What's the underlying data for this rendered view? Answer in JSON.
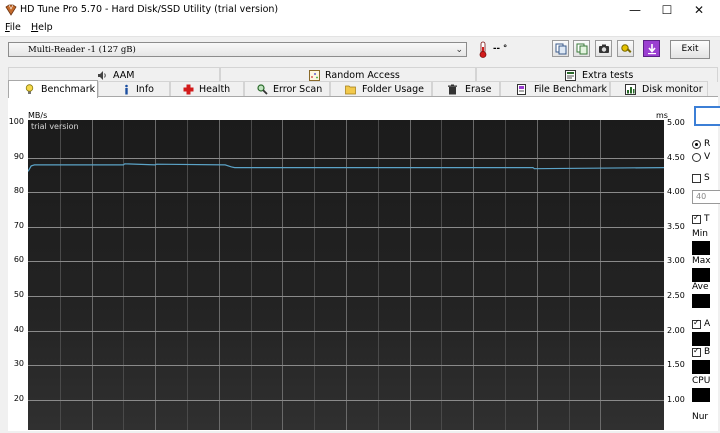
{
  "window": {
    "title": "HD Tune Pro 5.70 - Hard Disk/SSD Utility (trial version)",
    "minimize": "—",
    "maximize": "☐",
    "close": "✕"
  },
  "menu": [
    {
      "letter": "F",
      "rest": "ile"
    },
    {
      "letter": "H",
      "rest": "elp"
    }
  ],
  "toolbar": {
    "drive": "Multi-Reader  -1 (127 gB)",
    "temperature": "-- ",
    "temperature_unit": "°",
    "exit_label": "Exit"
  },
  "tabs_top": [
    "AAM",
    "Random Access",
    "Extra tests"
  ],
  "tabs_bottom": [
    "Benchmark",
    "Info",
    "Health",
    "Error Scan",
    "Folder Usage",
    "Erase",
    "File Benchmark",
    "Disk monitor"
  ],
  "active_tab": "Benchmark",
  "chart_data": {
    "type": "line",
    "watermark": "trial version",
    "ylabel_left": "MB/s",
    "ylabel_right": "ms",
    "yticks_left": [
      "100",
      "90",
      "80",
      "70",
      "60",
      "50",
      "40",
      "30",
      "20"
    ],
    "yticks_right": [
      "5.00",
      "4.50",
      "4.00",
      "3.50",
      "3.00",
      "2.50",
      "2.00",
      "1.50",
      "1.00"
    ],
    "ylim_left": [
      0,
      100
    ],
    "ylim_right": [
      0,
      5
    ],
    "grid": true,
    "series": [
      {
        "color": "#5ba3c7",
        "x": [
          0,
          0.5,
          1,
          15,
          15.2,
          20,
          20.2,
          31,
          32,
          32.5,
          45,
          60,
          79.4,
          79.6,
          100
        ],
        "values": [
          86,
          87.6,
          87.9,
          87.9,
          88.2,
          87.9,
          88.1,
          87.9,
          87.3,
          87.1,
          87.1,
          87.1,
          87.1,
          86.8,
          87.1
        ]
      }
    ]
  },
  "side_panel": {
    "labels": [
      "R",
      "V",
      "S",
      "40",
      "T",
      "Min",
      "Max",
      "Ave",
      "A",
      "B",
      "CPU",
      "Nur"
    ]
  }
}
